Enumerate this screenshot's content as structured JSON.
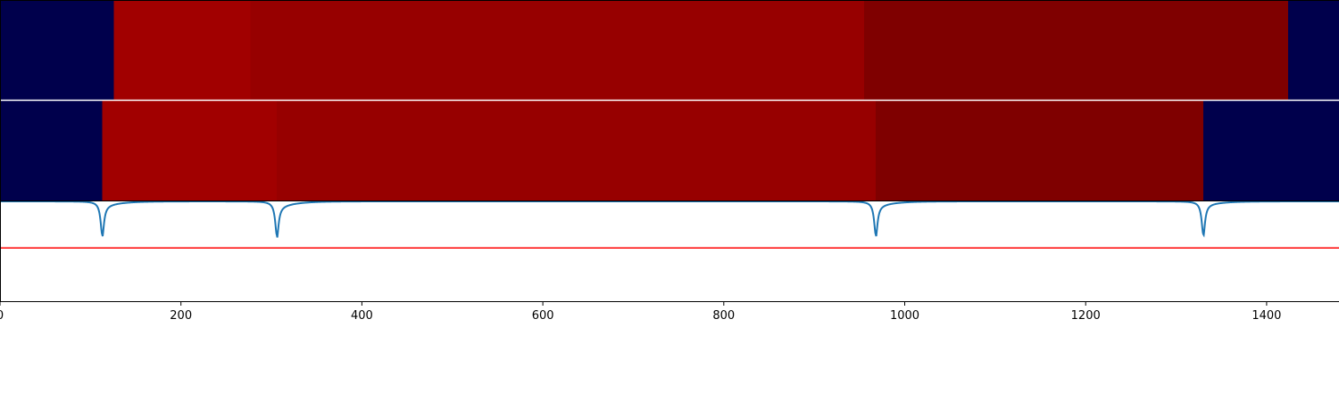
{
  "chart_data": {
    "type": "heatmap",
    "title": "",
    "xlabel": "",
    "ylabel": "",
    "xlim": [
      0,
      1480
    ],
    "x_ticks": [
      0,
      200,
      400,
      600,
      800,
      1000,
      1200,
      1400
    ],
    "x_tick_labels": [
      "0",
      "200",
      "400",
      "600",
      "800",
      "1000",
      "1200",
      "1400"
    ],
    "grid": false,
    "rows": [
      {
        "segments": [
          {
            "start": 0,
            "end": 126,
            "color": "#00004c"
          },
          {
            "start": 126,
            "end": 277,
            "color": "#a10000"
          },
          {
            "start": 277,
            "end": 955,
            "color": "#970000"
          },
          {
            "start": 955,
            "end": 1424,
            "color": "#7f0000"
          },
          {
            "start": 1424,
            "end": 1480,
            "color": "#00004c"
          }
        ]
      },
      {
        "segments": [
          {
            "start": 0,
            "end": 113,
            "color": "#00004c"
          },
          {
            "start": 113,
            "end": 306,
            "color": "#a10000"
          },
          {
            "start": 306,
            "end": 968,
            "color": "#970000"
          },
          {
            "start": 968,
            "end": 1330,
            "color": "#7f0000"
          },
          {
            "start": 1330,
            "end": 1480,
            "color": "#00004c"
          }
        ]
      }
    ],
    "signal": {
      "color": "#1f77b4",
      "baseline": 1.0,
      "ylim": [
        -0.5,
        1.0
      ],
      "dips": [
        {
          "x": 113,
          "depth": 0.52,
          "right_tail": 0.08
        },
        {
          "x": 306,
          "depth": 0.52,
          "right_tail": 0.1
        },
        {
          "x": 968,
          "depth": 0.52,
          "right_tail": 0.08
        },
        {
          "x": 1330,
          "depth": 0.52,
          "right_tail": 0.06
        }
      ]
    },
    "threshold": {
      "value": 0.3,
      "color": "#ff0000"
    }
  }
}
